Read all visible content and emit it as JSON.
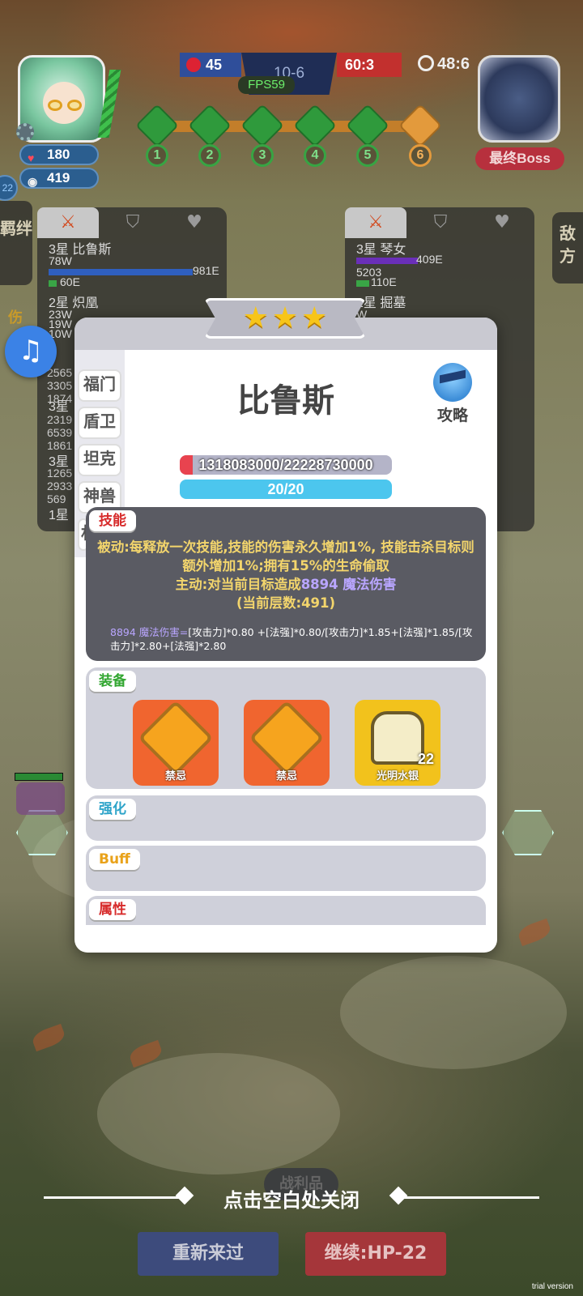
{
  "hud": {
    "hearts": "180",
    "coins": "419",
    "left_side_badge": "22",
    "score_blue": "45",
    "stage": "10-6",
    "score_red": "60:3",
    "fps": "FPS59",
    "timer": "48:6",
    "boss_label": "最终Boss",
    "waves": [
      "1",
      "2",
      "3",
      "4",
      "5",
      "6"
    ]
  },
  "side_tabs": {
    "left": "羁绊",
    "left_sub": "伤",
    "right": "敌方"
  },
  "damage_left": {
    "rows": [
      {
        "name": "3星 比鲁斯",
        "value": "78W",
        "total": "981E",
        "sub": "60E"
      },
      {
        "name": "2星 炽凰",
        "value": "23W",
        "extra": [
          "19W",
          "10W"
        ]
      }
    ],
    "side_values": [
      "2565",
      "3305",
      "1874",
      "2319",
      "6539",
      "1861",
      "1265",
      "2933",
      "569"
    ],
    "star_labels": [
      "3星",
      "3星",
      "1星"
    ]
  },
  "damage_right": {
    "rows": [
      {
        "name": "3星 琴女",
        "value": "5203",
        "total": "409E",
        "sub": "110E"
      },
      {
        "name": "2星 掘墓",
        "value": "W"
      }
    ]
  },
  "modal": {
    "stars": 3,
    "categories": [
      "福门",
      "盾卫",
      "坦克",
      "神兽",
      "林"
    ],
    "hero_name": "比鲁斯",
    "guide_label": "攻略",
    "hp_text": "1318083000/22228730000",
    "hp_fraction": 0.06,
    "mp_text": "20/20",
    "skill": {
      "tag": "技能",
      "passive": "被动:每释放一次技能,技能的伤害永久增加1%, 技能击杀目标则额外增加1%;拥有15%的生命偷取",
      "active_prefix": "主动:对当前目标造成",
      "active_value": "8894",
      "active_suffix": "魔法伤害",
      "layers": "(当前层数:491)",
      "formula_head": "8894 魔法伤害=",
      "formula_body": "[攻击力]*0.80 +[法强]*0.80/[攻击力]*1.85+[法强]*1.85/[攻击力]*2.80+[法强]*2.80"
    },
    "equipment": {
      "tag": "装备",
      "items": [
        {
          "label": "禁忌",
          "color": "#f0652f",
          "count": ""
        },
        {
          "label": "禁忌",
          "color": "#f0652f",
          "count": ""
        },
        {
          "label": "光明水银",
          "color": "#f2c21c",
          "count": "22"
        }
      ]
    },
    "strengthen_tag": "强化",
    "buff_tag": "Buff",
    "attr_tag": "属性"
  },
  "bottom": {
    "close_hint": "点击空白处关闭",
    "loot": "战利品",
    "restart": "重新来过",
    "continue": "继续:HP-22",
    "watermark": "trial version"
  },
  "colors": {
    "skill_tag": "#d72b2b",
    "equip_tag": "#31a630",
    "strengthen_tag": "#2ea4c9",
    "buff_tag": "#e9a21a",
    "attr_tag": "#d72b2b"
  }
}
